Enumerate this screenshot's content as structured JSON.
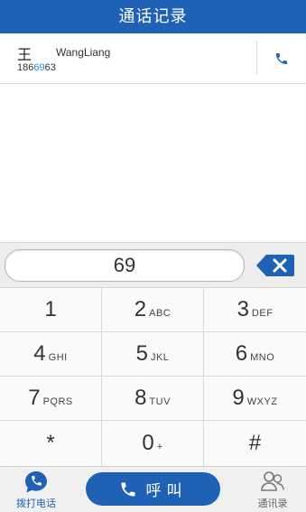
{
  "header": {
    "title": "通话记录"
  },
  "call_log": [
    {
      "surname": "王",
      "name": "WangLiang",
      "number_prefix": "186",
      "number_match": "69",
      "number_suffix": "63"
    }
  ],
  "dialer": {
    "input_value": "69",
    "keys": [
      {
        "digit": "1",
        "letters": ""
      },
      {
        "digit": "2",
        "letters": "ABC"
      },
      {
        "digit": "3",
        "letters": "DEF"
      },
      {
        "digit": "4",
        "letters": "GHI"
      },
      {
        "digit": "5",
        "letters": "JKL"
      },
      {
        "digit": "6",
        "letters": "MNO"
      },
      {
        "digit": "7",
        "letters": "PQRS"
      },
      {
        "digit": "8",
        "letters": "TUV"
      },
      {
        "digit": "9",
        "letters": "WXYZ"
      },
      {
        "digit": "*",
        "letters": ""
      },
      {
        "digit": "0",
        "letters": "+"
      },
      {
        "digit": "#",
        "letters": ""
      }
    ]
  },
  "bottom_bar": {
    "dial_tab_label": "拨打电话",
    "call_button_label": "呼叫",
    "contacts_tab_label": "通讯录"
  },
  "colors": {
    "accent": "#1f62b5",
    "match_highlight": "#2a8fe0"
  },
  "icons": {
    "phone": "phone-icon",
    "backspace": "backspace-icon",
    "dial_tab": "chat-bubble-phone-icon",
    "contacts": "contacts-icon"
  }
}
